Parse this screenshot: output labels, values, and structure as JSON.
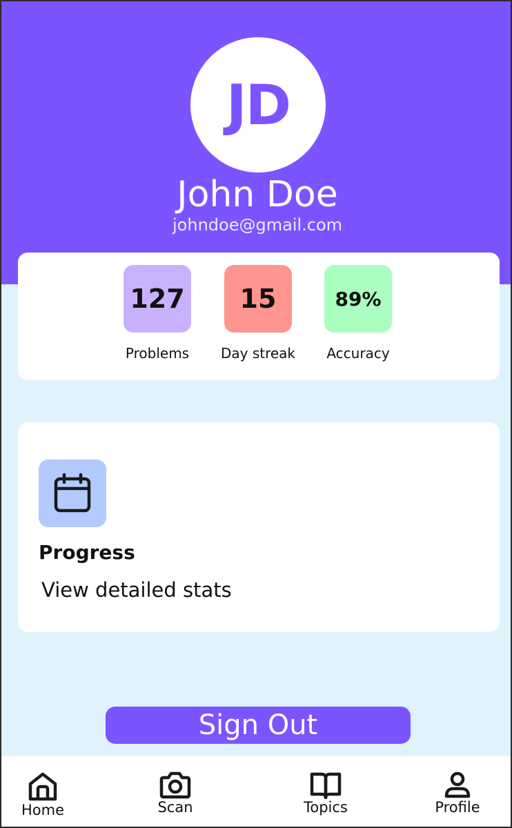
{
  "profile": {
    "initials": "JD",
    "name": "John Doe",
    "email": "johndoe@gmail.com"
  },
  "stats": [
    {
      "value": "127",
      "label": "Problems",
      "color": "#c8b2ff"
    },
    {
      "value": "15",
      "label": "Day streak",
      "color": "#ff9590"
    },
    {
      "value": "89%",
      "label": "Accuracy",
      "color": "#aaffc0"
    }
  ],
  "progress": {
    "icon": "calendar-icon",
    "title": "Progress",
    "subtitle": "View detailed stats"
  },
  "actions": {
    "sign_out_label": "Sign Out"
  },
  "nav": [
    {
      "label": "Home",
      "icon": "home-icon"
    },
    {
      "label": "Scan",
      "icon": "camera-icon"
    },
    {
      "label": "Topics",
      "icon": "book-icon"
    },
    {
      "label": "Profile",
      "icon": "user-icon"
    }
  ],
  "colors": {
    "accent": "#7b54ff",
    "background": "#dff3fd",
    "calendar_tile": "#b3caff"
  }
}
